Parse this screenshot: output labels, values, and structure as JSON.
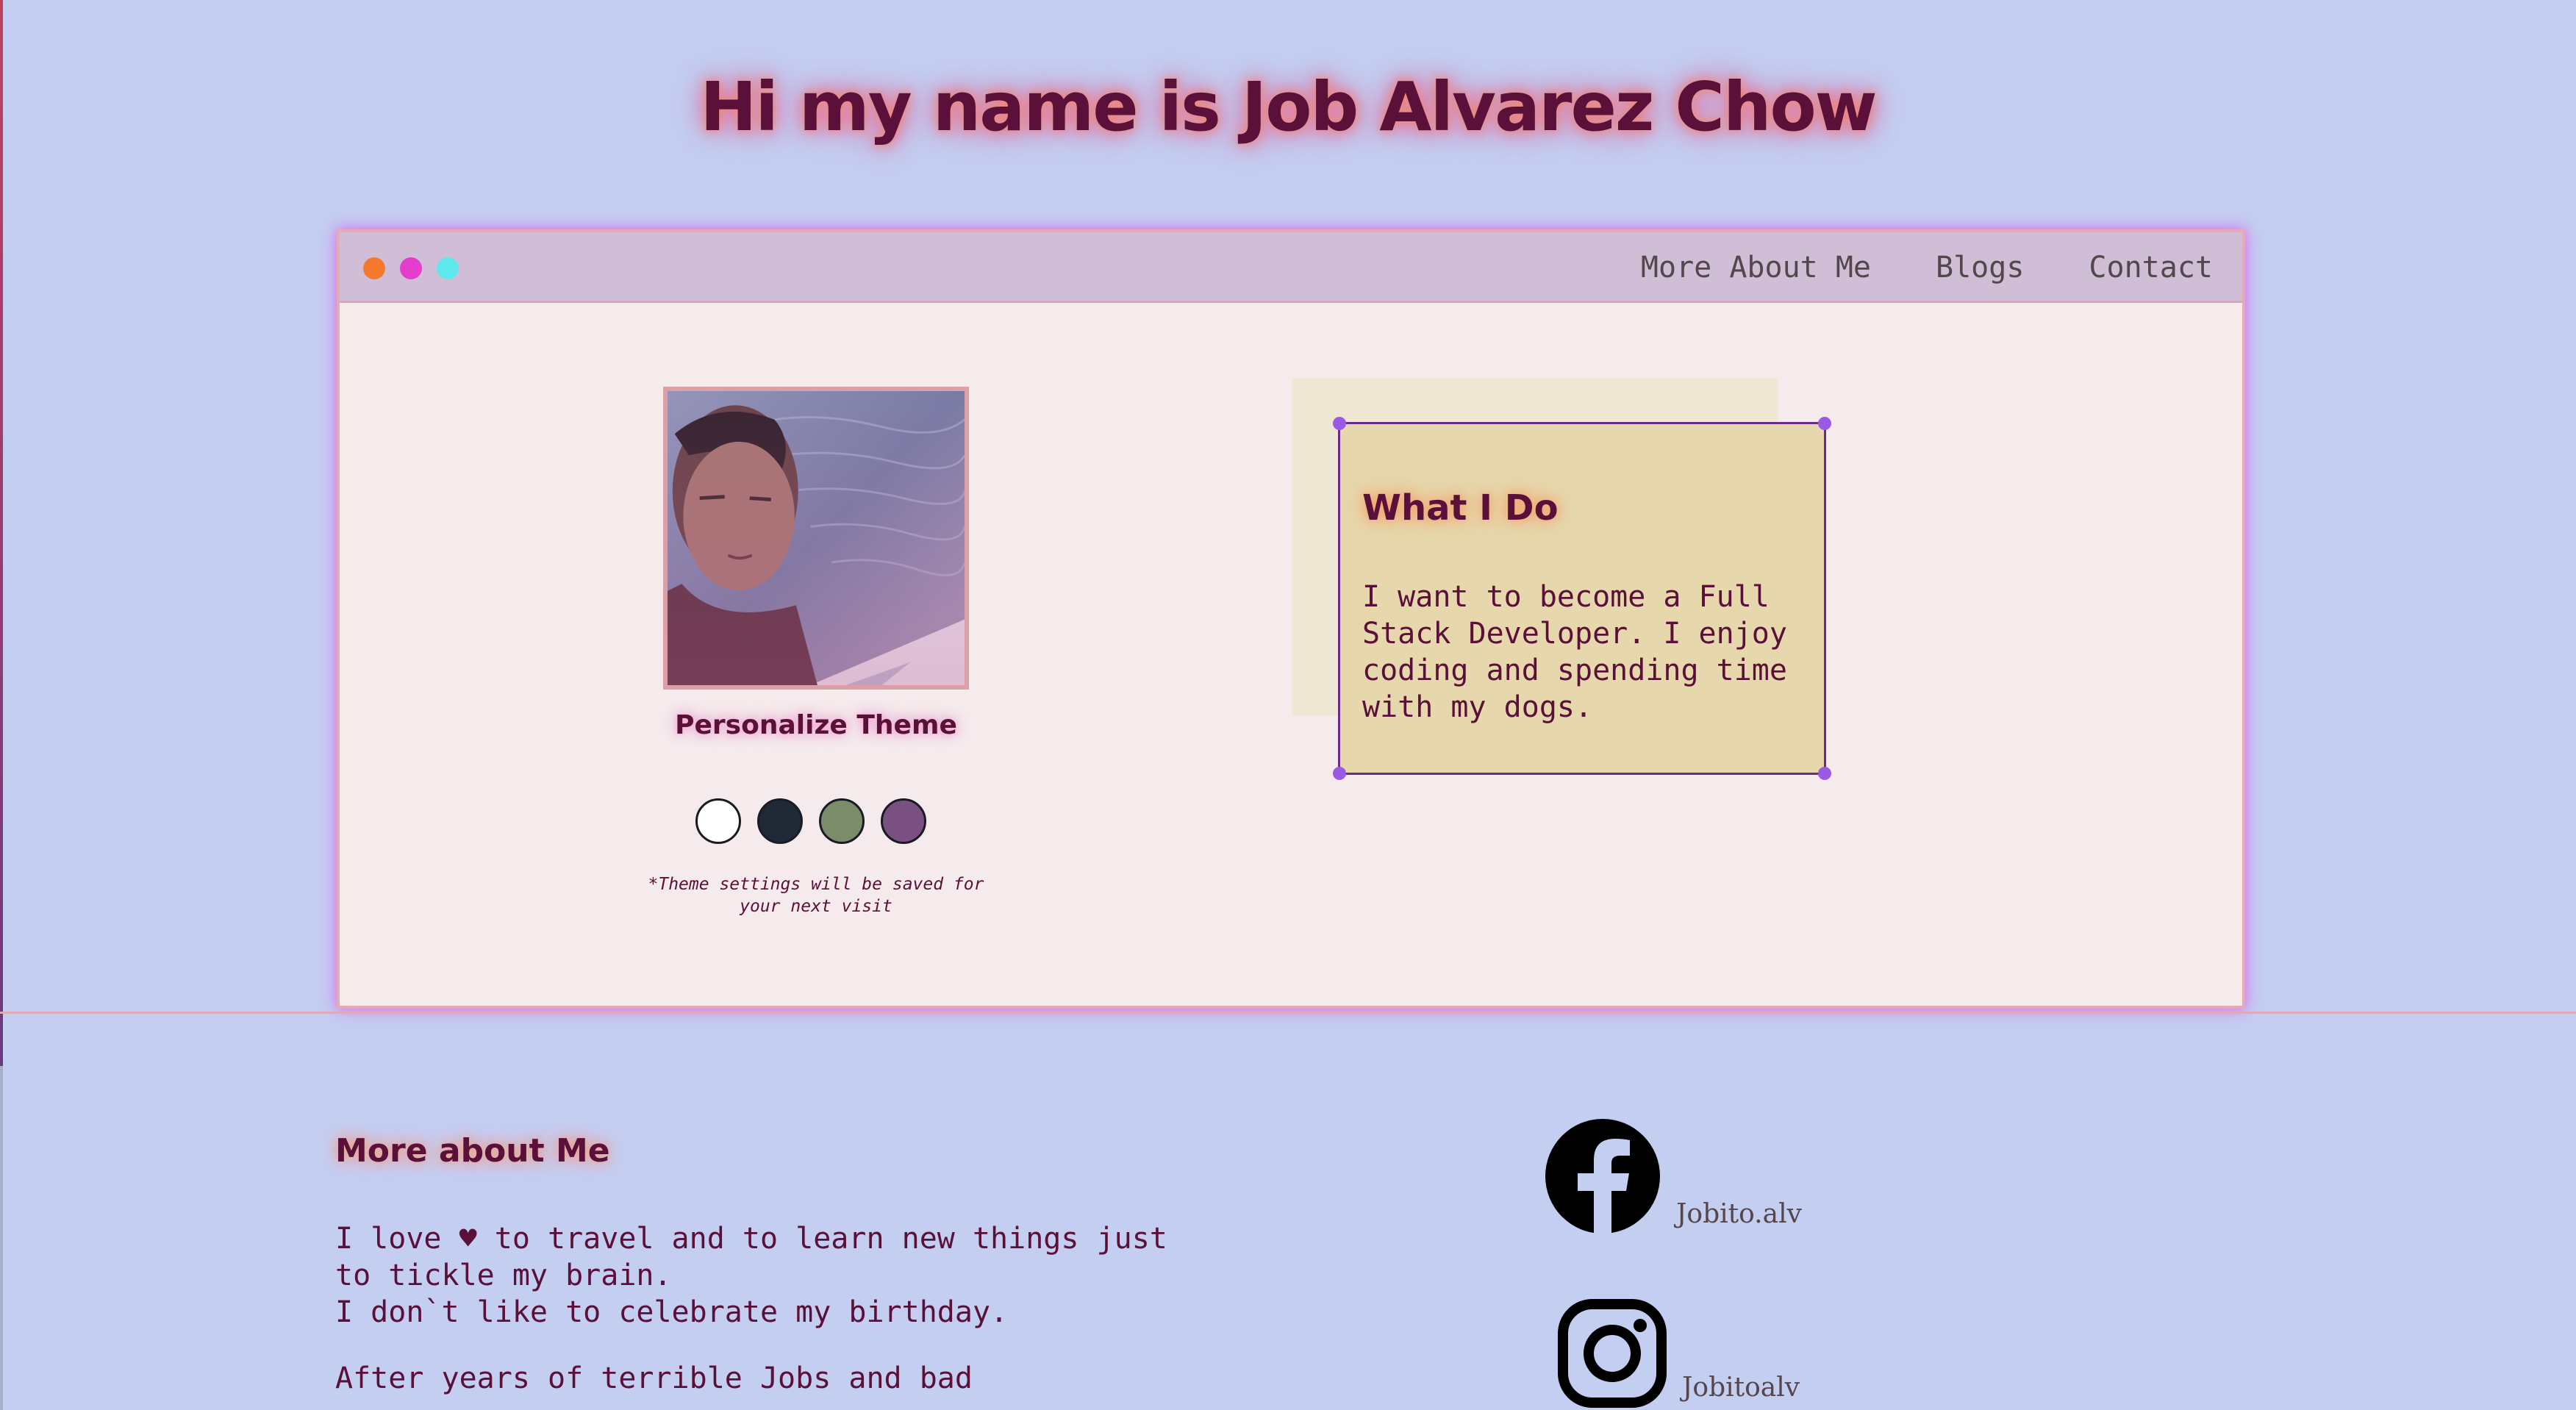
{
  "header": {
    "title": "Hi my name is Job Alvarez Chow"
  },
  "window": {
    "nav": {
      "items": [
        {
          "label": "More About Me"
        },
        {
          "label": "Blogs"
        },
        {
          "label": "Contact"
        }
      ]
    }
  },
  "profile": {
    "personalize_label": "Personalize Theme",
    "theme_swatches": [
      {
        "name": "white",
        "color": "#ffffff"
      },
      {
        "name": "dark-navy",
        "color": "#1f2a36"
      },
      {
        "name": "sage-green",
        "color": "#7b8c6a"
      },
      {
        "name": "plum",
        "color": "#7a4f82"
      }
    ],
    "note_line1": "*Theme settings will be saved for",
    "note_line2": "your next visit"
  },
  "what_i_do": {
    "title": "What I Do",
    "body": "I want to become a Full Stack Developer. I enjoy coding and spending time with my dogs."
  },
  "about": {
    "title": "More about Me",
    "line1": "I love ♥ to travel and to learn new things just",
    "line2": "to tickle my brain.",
    "line3": "I don`t like to celebrate my birthday.",
    "line4": "After years of terrible Jobs and bad"
  },
  "social": {
    "facebook_handle": "Jobito.alv",
    "instagram_handle": "Jobitoalv"
  },
  "colors": {
    "background": "#c3cef1",
    "window_bg": "#f5ebec",
    "titlebar_bg": "#cfbed6",
    "text_primary": "#5a1038",
    "card_bg": "#e6d7ad",
    "dot_orange": "#f4792e",
    "dot_magenta": "#e63ecc",
    "dot_cyan": "#5ee8ee"
  }
}
